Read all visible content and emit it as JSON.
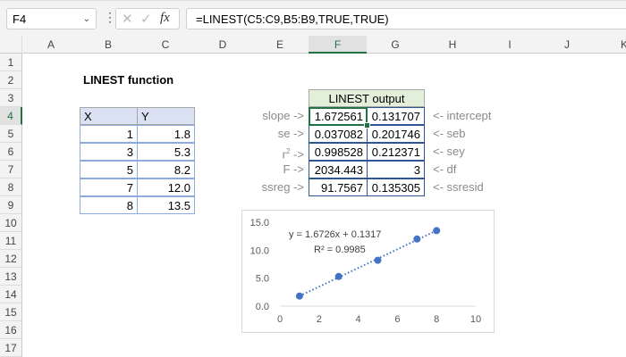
{
  "formula_bar": {
    "name_box": "F4",
    "formula": "=LINEST(C5:C9,B5:B9,TRUE,TRUE)",
    "cancel_icon": "✕",
    "enter_icon": "✓",
    "fx_icon": "fx"
  },
  "columns": [
    "A",
    "B",
    "C",
    "D",
    "E",
    "F",
    "G",
    "H",
    "I",
    "J",
    "K"
  ],
  "rows": [
    "1",
    "2",
    "3",
    "4",
    "5",
    "6",
    "7",
    "8",
    "9",
    "10",
    "11",
    "12",
    "13",
    "14",
    "15",
    "16",
    "17"
  ],
  "title": "LINEST function",
  "table": {
    "headers": [
      "X",
      "Y"
    ],
    "rows": [
      [
        "1",
        "1.8"
      ],
      [
        "3",
        "5.3"
      ],
      [
        "5",
        "8.2"
      ],
      [
        "7",
        "12.0"
      ],
      [
        "8",
        "13.5"
      ]
    ]
  },
  "output": {
    "header": "LINEST output",
    "left_labels": [
      "slope ->",
      "se ->",
      "r",
      "F ->",
      "ssreg ->"
    ],
    "r2_sup": "2",
    "r2_arrow": " ->",
    "values": [
      [
        "1.672561",
        "0.131707"
      ],
      [
        "0.037082",
        "0.201746"
      ],
      [
        "0.998528",
        "0.212371"
      ],
      [
        "2034.443",
        "3"
      ],
      [
        "91.7567",
        "0.135305"
      ]
    ],
    "right_labels": [
      "<- intercept",
      "<- seb",
      "<- sey",
      "<- df",
      "<- ssresid"
    ]
  },
  "chart_data": {
    "type": "scatter",
    "x": [
      1,
      3,
      5,
      7,
      8
    ],
    "y": [
      1.8,
      5.3,
      8.2,
      12.0,
      13.5
    ],
    "xlim": [
      0,
      10
    ],
    "ylim": [
      0,
      15
    ],
    "xticks": [
      "0",
      "2",
      "4",
      "6",
      "8",
      "10"
    ],
    "yticks": [
      "0.0",
      "5.0",
      "10.0",
      "15.0"
    ],
    "trendline": {
      "slope": 1.6726,
      "intercept": 0.1317,
      "equation": "y = 1.6726x + 0.1317",
      "r2_label": "R² = 0.9985"
    },
    "color": "#4472c4",
    "legend": "none",
    "grid": false
  }
}
